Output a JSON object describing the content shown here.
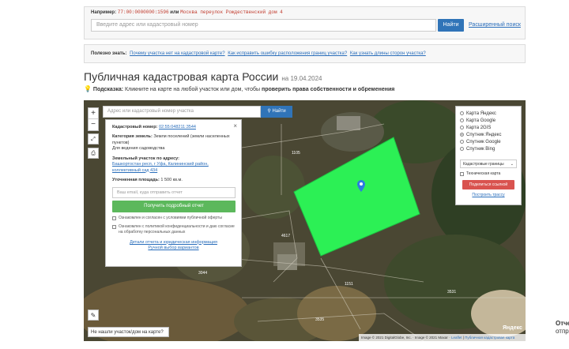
{
  "search": {
    "example_label": "Например:",
    "example_number": "77:00:0000000:1596",
    "example_or": "или",
    "example_address": "Москва переулок Рождественский дом 4",
    "placeholder": "Введите адрес или кадастровый номер",
    "button": "Найти",
    "advanced_link": "Расширенный поиск"
  },
  "useful": {
    "label": "Полезно знать:",
    "links": [
      "Почему участка нет на кадастровой карте?",
      "Как исправить ошибку расположения границ участка?",
      "Как узнать длины сторон участка?"
    ]
  },
  "page": {
    "title": "Публичная кадастровая карта России",
    "date": "на 19.04.2024",
    "hint_label": "Подсказка:",
    "hint_text": "Кликните на карте на любой участок или дом, чтобы",
    "hint_bold": "проверить права собственности и обременения"
  },
  "map": {
    "search_placeholder": "Адрес или кадастровый номер участка",
    "search_button": "Найти",
    "zoom_in": "+",
    "zoom_out": "−",
    "info": {
      "cadastral_label": "Кадастровый номер:",
      "cadastral_value": "02:55:048211:3544",
      "category_label": "Категория земель:",
      "category_value": "Земли поселений (земли населенных пунктов)",
      "usage_value": "Для ведения садоводства",
      "address_label": "Земельный участок по адресу:",
      "address_value": "Башкортостан респ, г Уфа, Калининский район, коллективный сад 434",
      "area_label": "Уточненная площадь:",
      "area_value": "1 500 кв.м.",
      "email_placeholder": "Ваш email, куда отправить отчет",
      "report_button": "Получить подробный отчет",
      "consent1": "Ознакомлен и согласен с условиями публичной оферты",
      "consent2": "Ознакомлен с политикой конфиденциальности и даю согласие на обработку персональных данных",
      "link1": "Детали отчета и юридическая информация",
      "link2": "Ручной выбор вариантов"
    },
    "layers": {
      "options": [
        "Карта Яндекс",
        "Карта Google",
        "Карта 2GIS",
        "Спутник Яндекс",
        "Спутник Google",
        "Спутник Bing"
      ],
      "selected": "Спутник Яндекс",
      "select_value": "Кадастровые границы",
      "tech_map": "Техническая карта",
      "share_button": "Поделиться ссылкой",
      "route_link": "Построить трассу"
    },
    "not_found": "Не нашли участок/дом на карте?",
    "attribution": "Image © 2021 DigitalGlobe, Inc. · Image © 2021 Maxar",
    "leaflet": "Leaflet",
    "attribution_link": "Публичная кадастровая карта",
    "yandex": "Яндекс",
    "parcel_numbers": [
      "1105",
      "4617",
      "3044",
      "1151",
      "3535",
      "3531"
    ]
  },
  "side": {
    "line1": "Отче",
    "line2": "отпра"
  },
  "colors": {
    "primary": "#3074b8",
    "parcel": "#2cf055",
    "report_button": "#5cb85c",
    "share_button": "#d9534f"
  }
}
